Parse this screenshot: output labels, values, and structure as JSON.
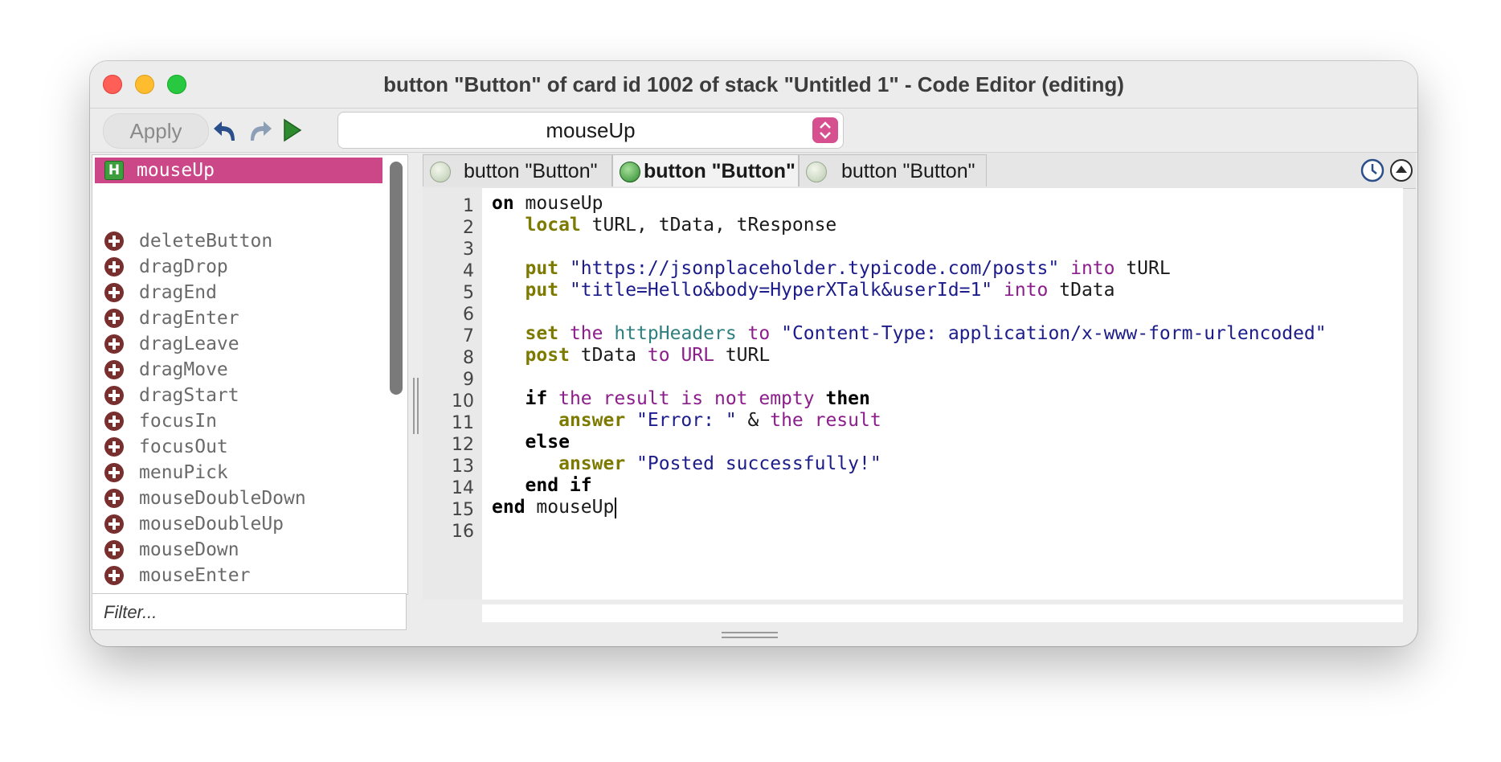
{
  "window": {
    "title": "button \"Button\" of card id 1002 of stack \"Untitled 1\" - Code Editor (editing)"
  },
  "toolbar": {
    "apply_label": "Apply",
    "handler_selected": "mouseUp"
  },
  "icons": {
    "undo": "undo-arrow-icon",
    "redo": "redo-arrow-icon",
    "run": "run-triangle-icon",
    "history": "clock-icon",
    "collapse": "eject-icon",
    "handler": "handler-h-icon",
    "add": "plus-circle-icon"
  },
  "colors": {
    "selection": "#cc4787",
    "select_arrow": "#d64f8e",
    "keyword": "#000000",
    "command": "#7d7a00",
    "property": "#8c1e8c",
    "string": "#1c1c8a"
  },
  "sidebar": {
    "selected_handler": "mouseUp",
    "messages": [
      "deleteButton",
      "dragDrop",
      "dragEnd",
      "dragEnter",
      "dragLeave",
      "dragMove",
      "dragStart",
      "focusIn",
      "focusOut",
      "menuPick",
      "mouseDoubleDown",
      "mouseDoubleUp",
      "mouseDown",
      "mouseEnter"
    ],
    "filter_placeholder": "Filter..."
  },
  "tabs": [
    {
      "label": "button \"Button\"",
      "active": false
    },
    {
      "label": "button \"Button\"",
      "active": true
    },
    {
      "label": "button \"Button\"",
      "active": false
    }
  ],
  "editor": {
    "line_numbers": [
      "1",
      "2",
      "3",
      "4",
      "5",
      "6",
      "7",
      "8",
      "9",
      "10",
      "11",
      "12",
      "13",
      "14",
      "15",
      "16"
    ],
    "code": {
      "l1": [
        "on",
        " mouseUp"
      ],
      "l2": [
        "   ",
        "local",
        " tURL, tData, tResponse"
      ],
      "l4": [
        "   ",
        "put",
        " ",
        "\"https://jsonplaceholder.typicode.com/posts\"",
        " ",
        "into",
        " tURL"
      ],
      "l5": [
        "   ",
        "put",
        " ",
        "\"title=Hello&body=HyperXTalk&userId=1\"",
        " ",
        "into",
        " tData"
      ],
      "l7": [
        "   ",
        "set",
        " ",
        "the",
        " ",
        "httpHeaders",
        " ",
        "to",
        " ",
        "\"Content-Type: application/x-www-form-urlencoded\""
      ],
      "l8": [
        "   ",
        "post",
        " tData ",
        "to",
        " ",
        "URL",
        " tURL"
      ],
      "l10": [
        "   ",
        "if",
        " ",
        "the result is not empty",
        " ",
        "then"
      ],
      "l11": [
        "      ",
        "answer",
        " ",
        "\"Error: \"",
        " & ",
        "the result"
      ],
      "l12": [
        "   ",
        "else"
      ],
      "l13": [
        "      ",
        "answer",
        " ",
        "\"Posted successfully!\""
      ],
      "l14": [
        "   ",
        "end if"
      ],
      "l15": [
        "end",
        " mouseUp"
      ]
    }
  }
}
